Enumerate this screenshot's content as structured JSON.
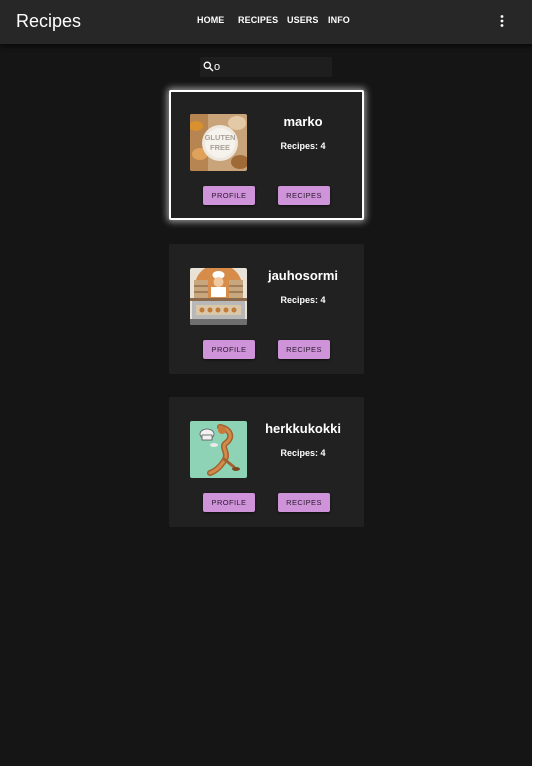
{
  "app": {
    "title": "Recipes"
  },
  "nav": {
    "items": [
      {
        "label": "HOME"
      },
      {
        "label": "RECIPES"
      },
      {
        "label": "USERS"
      },
      {
        "label": "INFO"
      }
    ],
    "menu_icon": "more-vertical-icon"
  },
  "search": {
    "value": "o",
    "icon": "search-icon"
  },
  "users": [
    {
      "name": "marko",
      "recipes_label": "Recipes: 4",
      "profile_label": "PROFILE",
      "recipes_button": "RECIPES",
      "avatar": "gluten-free-flour-image"
    },
    {
      "name": "jauhosormi",
      "recipes_label": "Recipes: 4",
      "profile_label": "PROFILE",
      "recipes_button": "RECIPES",
      "avatar": "baker-shop-illustration"
    },
    {
      "name": "herkkukokki",
      "recipes_label": "Recipes: 4",
      "profile_label": "PROFILE",
      "recipes_button": "RECIPES",
      "avatar": "chef-cartoon-illustration"
    }
  ],
  "colors": {
    "background": "#151515",
    "appbar": "#272727",
    "card": "#212121",
    "button": "#ce93d8",
    "button_text": "#2a1a2d"
  }
}
